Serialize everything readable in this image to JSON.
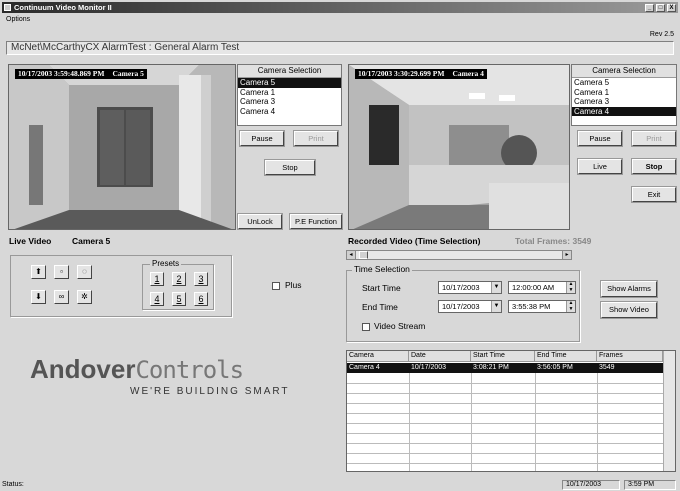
{
  "window": {
    "title": "Continuum Video Monitor II",
    "minimize": "_",
    "maximize": "□",
    "close": "X"
  },
  "menu": {
    "options": "Options"
  },
  "rev": "Rev 2.5",
  "alarm_title": "McNet\\McCarthyCX AlarmTest : General Alarm Test",
  "live": {
    "timestamp": "10/17/2003  3:59:48.869 PM",
    "camera_overlay": "Camera 5",
    "camera_selection_header": "Camera Selection",
    "cameras": [
      "Camera 5",
      "Camera 1",
      "Camera 3",
      "Camera 4"
    ],
    "selected_index": 0,
    "pause": "Pause",
    "print": "Print",
    "stop": "Stop",
    "unlock": "UnLock",
    "pe_function": "P.E Function",
    "label": "Live Video",
    "camera_label": "Camera 5"
  },
  "recorded": {
    "timestamp": "10/17/2003  3:30:29.699 PM",
    "camera_overlay": "Camera 4",
    "camera_selection_header": "Camera Selection",
    "cameras": [
      "Camera 5",
      "Camera 1",
      "Camera 3",
      "Camera 4"
    ],
    "selected_index": 3,
    "pause": "Pause",
    "print": "Print",
    "live": "Live",
    "stop": "Stop",
    "exit": "Exit",
    "label": "Recorded Video (Time Selection)",
    "total_frames_label": "Total Frames: 3549"
  },
  "ptz": {
    "up": "⬆",
    "down": "⬇",
    "zoom_in": "▫",
    "zoom_out": "∞",
    "focus_near": "◌",
    "focus_far": "✲",
    "presets_title": "Presets",
    "presets": [
      "1",
      "2",
      "3",
      "4",
      "5",
      "6"
    ],
    "plus_label": "Plus"
  },
  "time_selection": {
    "title": "Time Selection",
    "start_label": "Start Time",
    "end_label": "End Time",
    "start_date": "10/17/2003",
    "start_time": "12:00:00 AM",
    "end_date": "10/17/2003",
    "end_time": "3:55:38 PM",
    "video_stream": "Video Stream",
    "show_alarms": "Show Alarms",
    "show_video": "Show Video"
  },
  "table": {
    "headers": [
      "Camera",
      "Date",
      "Start Time",
      "End Time",
      "Frames"
    ],
    "rows": [
      [
        "Camera 4",
        "10/17/2003",
        "3:08:21 PM",
        "3:56:05 PM",
        "3549"
      ]
    ]
  },
  "logo": {
    "word1": "Andover",
    "word2": "Controls",
    "tagline": "WE'RE BUILDING SMART"
  },
  "status": {
    "label": "Status:",
    "date": "10/17/2003",
    "time": "3:59 PM"
  }
}
